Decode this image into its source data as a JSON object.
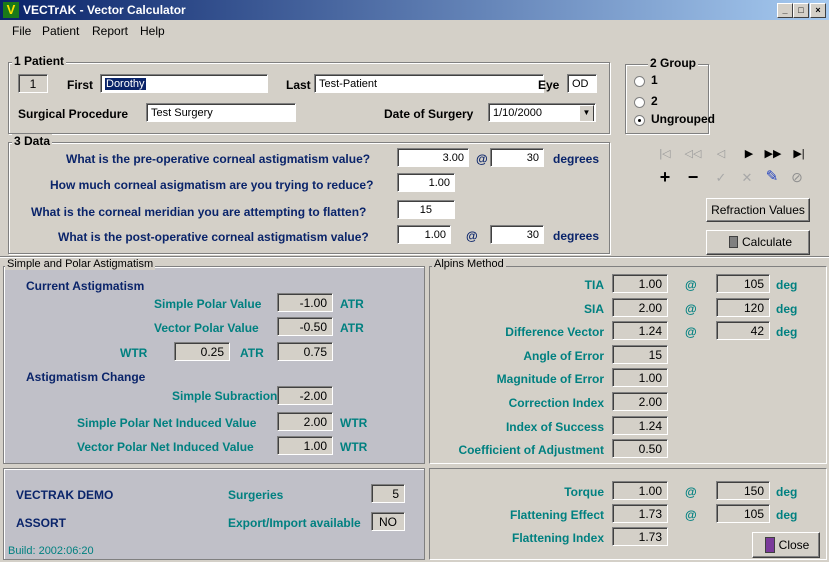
{
  "window": {
    "title": "VECTrAK - Vector Calculator",
    "icon_letter": "V",
    "minimize": "_",
    "maximize": "□",
    "close": "×"
  },
  "menu": [
    "File",
    "Patient",
    "Report",
    "Help"
  ],
  "patient": {
    "group_label": "1 Patient",
    "number": "1",
    "first_label": "First",
    "first_value": "Dorothy",
    "last_label": "Last",
    "last_value": "Test-Patient",
    "eye_label": "Eye",
    "eye_value": "OD",
    "procedure_label": "Surgical Procedure",
    "procedure_value": "Test Surgery",
    "date_label": "Date of Surgery",
    "date_value": "1/10/2000"
  },
  "group": {
    "label": "2 Group",
    "options": [
      "1",
      "2",
      "Ungrouped"
    ],
    "selected": "Ungrouped"
  },
  "data": {
    "label": "3 Data",
    "q1": "What is the pre-operative corneal astigmatism value?",
    "q1_value": "3.00",
    "q1_axis": "30",
    "q2": "How much corneal asigmatism are you trying to reduce?",
    "q2_value": "1.00",
    "q3": "What is the corneal meridian you are attempting to flatten?",
    "q3_value": "15",
    "q4": "What is the post-operative corneal astigmatism value?",
    "q4_value": "1.00",
    "q4_axis": "30",
    "at": "@",
    "degrees": "degrees"
  },
  "toolbar": {
    "nav": [
      "|◁",
      "◁◁",
      "◁",
      "▶",
      "▶▶",
      "▶|"
    ],
    "add": "+",
    "remove": "−",
    "confirm": "✓",
    "cancel": "✕",
    "edit": "✎",
    "clear": "⊘",
    "refraction_button": "Refraction Values",
    "calculate_button": "Calculate"
  },
  "simple_polar": {
    "title": "Simple and Polar Astigmatism",
    "current_heading": "Current Astigmatism",
    "simple_polar_label": "Simple Polar Value",
    "simple_polar_value": "-1.00",
    "simple_polar_unit": "ATR",
    "vector_polar_label": "Vector Polar Value",
    "vector_polar_value": "-0.50",
    "vector_polar_unit": "ATR",
    "wtr_label": "WTR",
    "wtr_value": "0.25",
    "atr_label": "ATR",
    "atr_value": "0.75",
    "change_heading": "Astigmatism Change",
    "simple_sub_label": "Simple Subraction",
    "simple_sub_value": "-2.00",
    "simple_net_label": "Simple Polar Net Induced Value",
    "simple_net_value": "2.00",
    "simple_net_unit": "WTR",
    "vector_net_label": "Vector Polar Net Induced Value",
    "vector_net_value": "1.00",
    "vector_net_unit": "WTR"
  },
  "alpins": {
    "title": "Alpins Method",
    "rows": [
      {
        "label": "TIA",
        "value": "1.00",
        "at": "@",
        "axis": "105",
        "unit": "deg"
      },
      {
        "label": "SIA",
        "value": "2.00",
        "at": "@",
        "axis": "120",
        "unit": "deg"
      },
      {
        "label": "Difference Vector",
        "value": "1.24",
        "at": "@",
        "axis": "42",
        "unit": "deg"
      },
      {
        "label": "Angle of Error",
        "value": "15"
      },
      {
        "label": "Magnitude of Error",
        "value": "1.00"
      },
      {
        "label": "Correction Index",
        "value": "2.00"
      },
      {
        "label": "Index of Success",
        "value": "1.24"
      },
      {
        "label": "Coefficient of Adjustment",
        "value": "0.50"
      }
    ],
    "bottom_rows": [
      {
        "label": "Torque",
        "value": "1.00",
        "at": "@",
        "axis": "150",
        "unit": "deg"
      },
      {
        "label": "Flattening Effect",
        "value": "1.73",
        "at": "@",
        "axis": "105",
        "unit": "deg"
      },
      {
        "label": "Flattening Index",
        "value": "1.73"
      }
    ]
  },
  "footer": {
    "demo": "VECTRAK DEMO",
    "assort": "ASSORT",
    "surgeries_label": "Surgeries",
    "surgeries_value": "5",
    "export_label": "Export/Import available",
    "export_value": "NO",
    "build": "Build: 2002:06:20",
    "close_button": "Close"
  },
  "colors": {
    "label_navy": "#0a246a",
    "label_teal": "#008080",
    "title_gradient_start": "#0a246a",
    "title_gradient_end": "#a6caf0",
    "app_icon": "#1a7a1a"
  }
}
